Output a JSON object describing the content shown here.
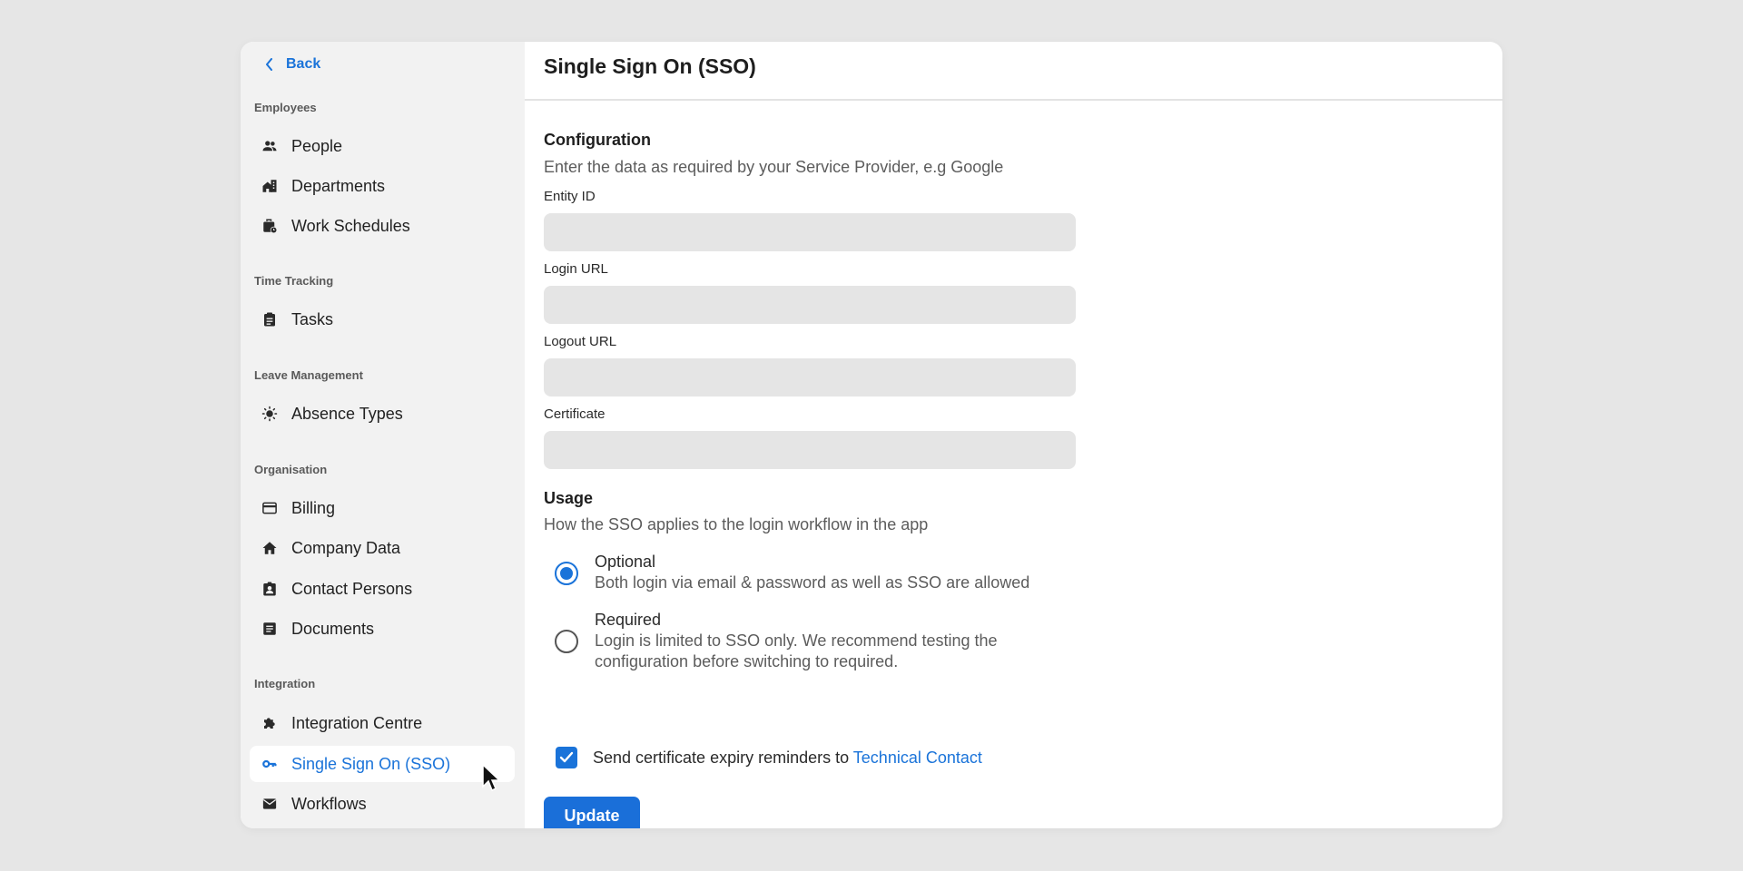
{
  "sidebar": {
    "back_label": "Back",
    "sections": [
      {
        "label": "Employees",
        "items": [
          {
            "label": "People",
            "icon": "people-icon"
          },
          {
            "label": "Departments",
            "icon": "building-icon"
          },
          {
            "label": "Work Schedules",
            "icon": "briefcase-clock-icon"
          }
        ]
      },
      {
        "label": "Time Tracking",
        "items": [
          {
            "label": "Tasks",
            "icon": "clipboard-icon"
          }
        ]
      },
      {
        "label": "Leave Management",
        "items": [
          {
            "label": "Absence Types",
            "icon": "sun-icon"
          }
        ]
      },
      {
        "label": "Organisation",
        "items": [
          {
            "label": "Billing",
            "icon": "credit-card-icon"
          },
          {
            "label": "Company Data",
            "icon": "home-icon"
          },
          {
            "label": "Contact Persons",
            "icon": "contact-badge-icon"
          },
          {
            "label": "Documents",
            "icon": "document-icon"
          }
        ]
      },
      {
        "label": "Integration",
        "items": [
          {
            "label": "Integration Centre",
            "icon": "puzzle-icon"
          },
          {
            "label": "Single Sign On (SSO)",
            "icon": "key-icon",
            "active": true
          },
          {
            "label": "Workflows",
            "icon": "mail-icon"
          }
        ]
      }
    ]
  },
  "page": {
    "title": "Single Sign On (SSO)",
    "configuration": {
      "heading": "Configuration",
      "description": "Enter the data as required by your Service Provider, e.g Google",
      "fields": [
        {
          "label": "Entity ID",
          "value": ""
        },
        {
          "label": "Login URL",
          "value": ""
        },
        {
          "label": "Logout URL",
          "value": ""
        },
        {
          "label": "Certificate",
          "value": ""
        }
      ]
    },
    "usage": {
      "heading": "Usage",
      "description": "How the SSO applies to the login workflow in the app",
      "options": [
        {
          "title": "Optional",
          "description": "Both login via email & password as well as SSO are allowed",
          "selected": true
        },
        {
          "title": "Required",
          "description_line1": "Login is limited to SSO only. We recommend testing the",
          "description_line2": "configuration before switching to required.",
          "selected": false
        }
      ]
    },
    "reminder": {
      "checked": true,
      "text": "Send certificate expiry reminders to ",
      "link": "Technical Contact"
    },
    "update_label": "Update"
  },
  "colors": {
    "accent": "#1a73d9",
    "sidebar_bg": "#f2f2f2",
    "page_bg": "#e6e6e6",
    "field_bg": "#e5e5e5"
  }
}
